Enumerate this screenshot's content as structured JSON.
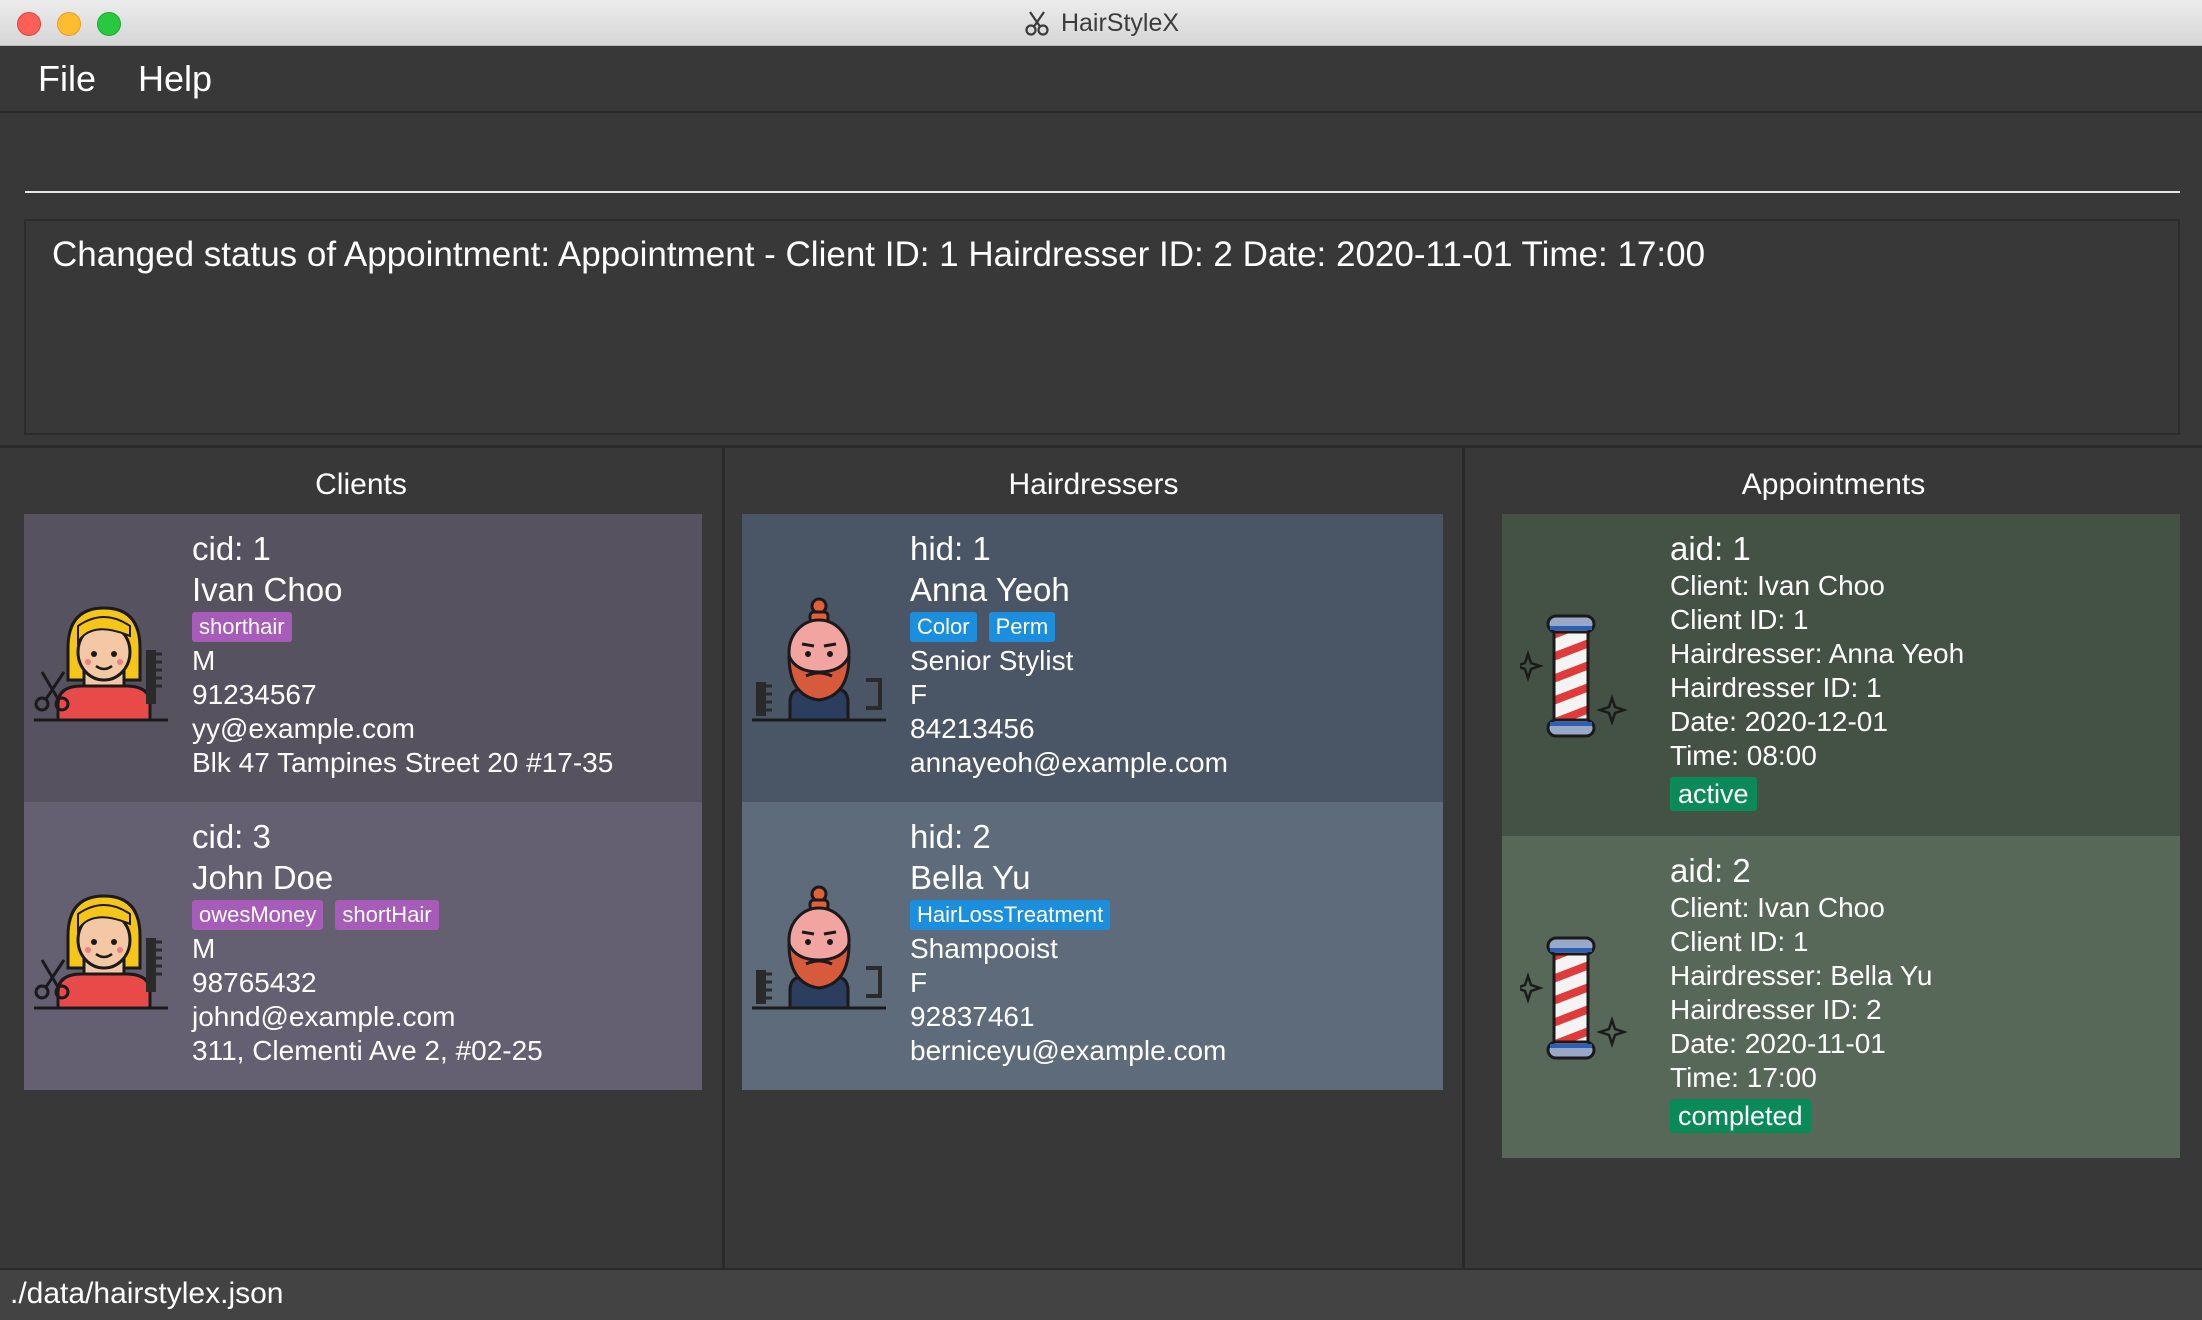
{
  "window": {
    "title": "HairStyleX"
  },
  "menu": {
    "file": "File",
    "help": "Help"
  },
  "command": {
    "value": ""
  },
  "result": {
    "message": "Changed status of Appointment: Appointment - Client ID: 1 Hairdresser ID: 2 Date: 2020-11-01 Time: 17:00"
  },
  "colors": {
    "client_card_1": "#575260",
    "client_card_2": "#655f72",
    "hairdresser_card_1": "#4a5666",
    "hairdresser_card_2": "#5d6b7a",
    "appointment_card_1": "#445245",
    "appointment_card_2": "#576758",
    "tag_client": "#a65cb8",
    "tag_hairdresser": "#1b8fde",
    "status_badge": "#0a8a58"
  },
  "clients": {
    "title": "Clients",
    "items": [
      {
        "cid": "cid: 1",
        "name": "Ivan Choo",
        "tags": [
          "shorthair"
        ],
        "gender": "M",
        "phone": "91234567",
        "email": "yy@example.com",
        "address": "Blk 47 Tampines Street 20 #17-35",
        "icon": "client-icon"
      },
      {
        "cid": "cid: 3",
        "name": "John Doe",
        "tags": [
          "owesMoney",
          "shortHair"
        ],
        "gender": "M",
        "phone": "98765432",
        "email": "johnd@example.com",
        "address": "311, Clementi Ave 2, #02-25",
        "icon": "client-icon"
      }
    ]
  },
  "hairdressers": {
    "title": "Hairdressers",
    "items": [
      {
        "hid": "hid: 1",
        "name": "Anna Yeoh",
        "tags": [
          "Color",
          "Perm"
        ],
        "title": "Senior Stylist",
        "gender": "F",
        "phone": "84213456",
        "email": "annayeoh@example.com",
        "icon": "hairdresser-icon"
      },
      {
        "hid": "hid: 2",
        "name": "Bella Yu",
        "tags": [
          "HairLossTreatment"
        ],
        "title": "Shampooist",
        "gender": "F",
        "phone": "92837461",
        "email": "berniceyu@example.com",
        "icon": "hairdresser-icon"
      }
    ]
  },
  "appointments": {
    "title": "Appointments",
    "items": [
      {
        "aid": "aid: 1",
        "client": "Client: Ivan Choo",
        "client_id": "Client ID: 1",
        "hairdresser": "Hairdresser: Anna Yeoh",
        "hairdresser_id": "Hairdresser ID: 1",
        "date": "Date: 2020-12-01",
        "time": "Time: 08:00",
        "status": "active",
        "icon": "barber-pole-icon"
      },
      {
        "aid": "aid: 2",
        "client": "Client: Ivan Choo",
        "client_id": "Client ID: 1",
        "hairdresser": "Hairdresser: Bella Yu",
        "hairdresser_id": "Hairdresser ID: 2",
        "date": "Date: 2020-11-01",
        "time": "Time: 17:00",
        "status": "completed",
        "icon": "barber-pole-icon"
      }
    ]
  },
  "statusbar": {
    "path": "./data/hairstylex.json"
  }
}
